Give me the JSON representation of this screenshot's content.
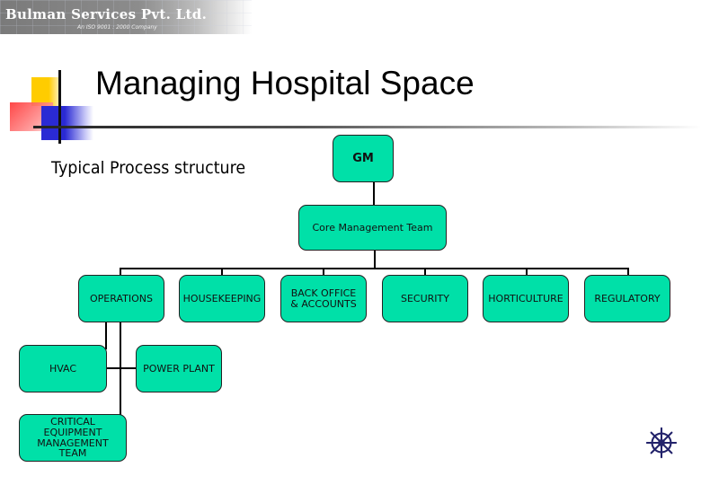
{
  "header": {
    "brand": "Bulman Services Pvt. Ltd.",
    "tagline": "An ISO 9001 : 2000 Company"
  },
  "slide": {
    "title": "Managing Hospital Space",
    "subtitle": "Typical Process structure"
  },
  "org_chart": {
    "root": "GM",
    "core": "Core Management Team",
    "departments": [
      "OPERATIONS",
      "HOUSEKEEPING",
      "BACK OFFICE & ACCOUNTS",
      "SECURITY",
      "HORTICULTURE",
      "REGULATORY"
    ],
    "operations_children": [
      "HVAC",
      "POWER PLANT",
      "CRITICAL EQUIPMENT MANAGEMENT TEAM"
    ],
    "box_color": "#00e0a8"
  },
  "footer": {
    "icon": "ship-wheel-icon"
  }
}
